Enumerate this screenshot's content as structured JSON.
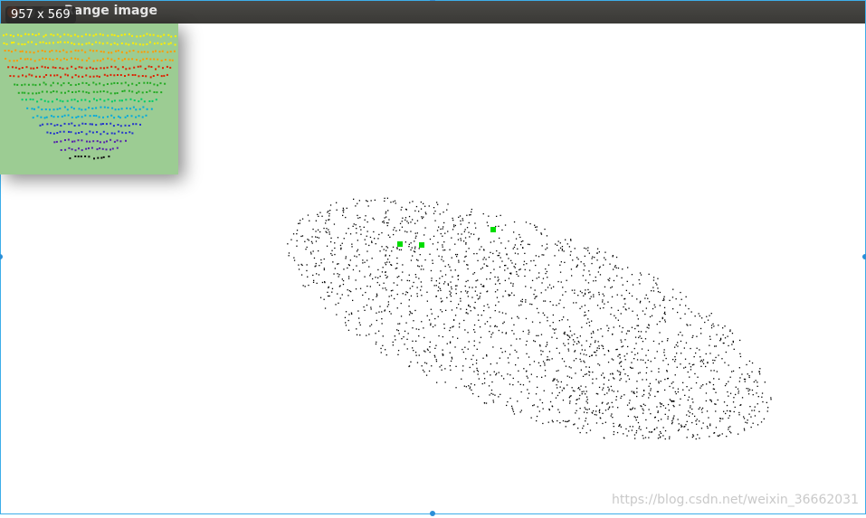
{
  "window": {
    "title": "Range image"
  },
  "dimension_badge": "957 x 569",
  "watermark": "https://blog.csdn.net/weixin_36662031",
  "colors": {
    "selection_frame": "#3daee9",
    "titlebar": "#3c3b37",
    "range_background": "#9ccc93",
    "viewer_background": "#ffffff",
    "marker": "#00dd00",
    "point": "#000000"
  },
  "icons": {
    "close": "close-icon",
    "minimize": "minimize-icon",
    "maximize": "maximize-icon"
  }
}
